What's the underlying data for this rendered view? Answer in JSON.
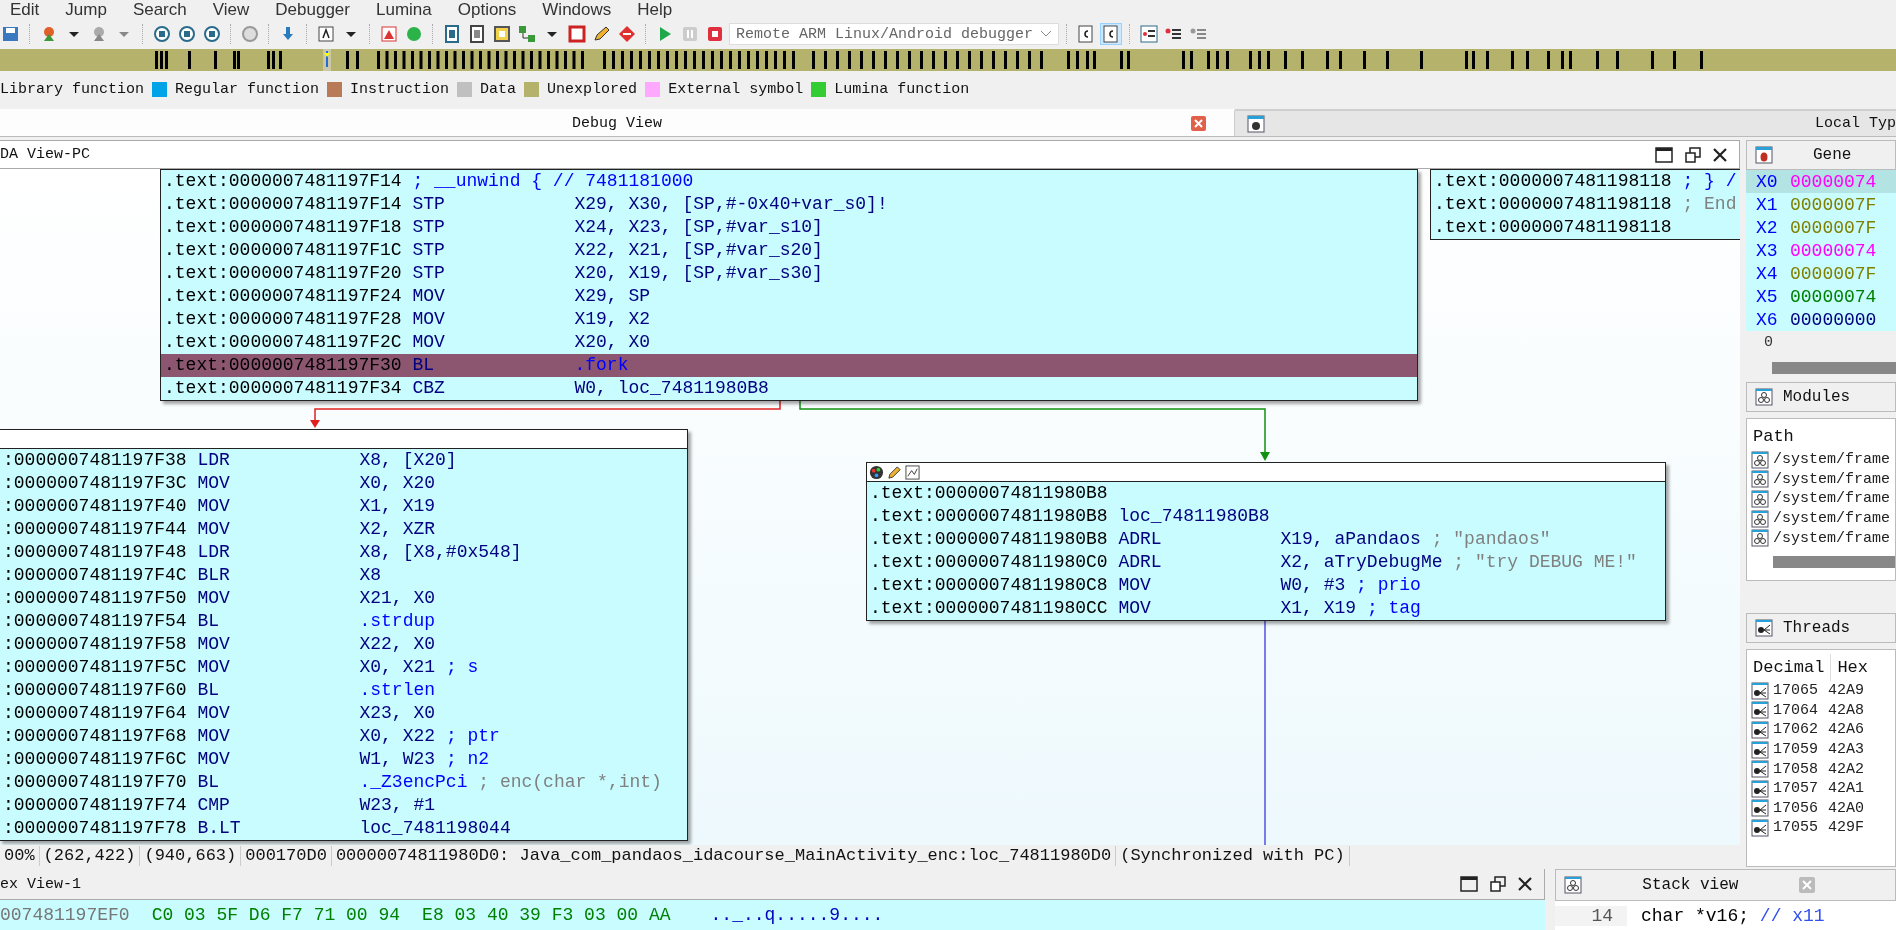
{
  "menu": [
    "Edit",
    "Jump",
    "Search",
    "View",
    "Debugger",
    "Lumina",
    "Options",
    "Windows",
    "Help"
  ],
  "toolbar": {
    "debugger_select": "Remote ARM Linux/Android debugger"
  },
  "legend": [
    {
      "label": "Library function"
    },
    {
      "label": "Regular function",
      "color": "#00a2e8"
    },
    {
      "label": "Instruction",
      "color": "#b97a57"
    },
    {
      "label": "Data",
      "color": "#c0c0c0"
    },
    {
      "label": "Unexplored",
      "color": "#b5b36b"
    },
    {
      "label": "External symbol",
      "color": "#ffa8ff"
    },
    {
      "label": "Lumina function",
      "color": "#33cc33"
    }
  ],
  "tabs": [
    {
      "label": "Debug View",
      "selected": true
    },
    {
      "label": "Local Typ",
      "selected": false
    }
  ],
  "ida_view": {
    "title": "DA View-PC",
    "blocks": [
      {
        "kind": "cut",
        "lines": [
          {
            "addr": ".text:0000007481197F14",
            "comment": "; __unwind { // 7481181000",
            "comment_grey": false,
            "selected": false
          },
          {
            "addr": ".text:0000007481197F14",
            "mnem": "STP",
            "ops": "X29, X30, [SP,#-0x40+var_s0]!",
            "selected": false
          },
          {
            "addr": ".text:0000007481197F18",
            "mnem": "STP",
            "ops": "X24, X23, [SP,#var_s10]",
            "selected": false
          },
          {
            "addr": ".text:0000007481197F1C",
            "mnem": "STP",
            "ops": "X22, X21, [SP,#var_s20]",
            "selected": false
          },
          {
            "addr": ".text:0000007481197F20",
            "mnem": "STP",
            "ops": "X20, X19, [SP,#var_s30]",
            "selected": false
          },
          {
            "addr": ".text:0000007481197F24",
            "mnem": "MOV",
            "ops": "X29, SP",
            "selected": false
          },
          {
            "addr": ".text:0000007481197F28",
            "mnem": "MOV",
            "ops": "X19, X2",
            "selected": false
          },
          {
            "addr": ".text:0000007481197F2C",
            "mnem": "MOV",
            "ops": "X20, X0",
            "selected": false
          },
          {
            "addr": ".text:0000007481197F30",
            "mnem": "BL",
            "ops": ".fork",
            "call": true,
            "selected": true
          },
          {
            "addr": ".text:0000007481197F34",
            "mnem": "CBZ",
            "ops": "W0, loc_74811980B8",
            "selected": false
          }
        ]
      },
      {
        "kind": "cut",
        "lines": [
          {
            "addr": ".text:0000007481198118",
            "comment": "; } /",
            "comment_grey": false
          },
          {
            "addr": ".text:0000007481198118",
            "comment": "; End",
            "comment_grey": true
          },
          {
            "addr": ".text:0000007481198118"
          }
        ]
      },
      {
        "kind": "header",
        "lines": [
          {
            "addr": ":0000007481197F38",
            "mnem": "LDR",
            "ops": "X8, [X20]"
          },
          {
            "addr": ":0000007481197F3C",
            "mnem": "MOV",
            "ops": "X0, X20"
          },
          {
            "addr": ":0000007481197F40",
            "mnem": "MOV",
            "ops": "X1, X19"
          },
          {
            "addr": ":0000007481197F44",
            "mnem": "MOV",
            "ops": "X2, XZR"
          },
          {
            "addr": ":0000007481197F48",
            "mnem": "LDR",
            "ops": "X8, [X8,#0x548]"
          },
          {
            "addr": ":0000007481197F4C",
            "mnem": "BLR",
            "ops": "X8"
          },
          {
            "addr": ":0000007481197F50",
            "mnem": "MOV",
            "ops": "X21, X0"
          },
          {
            "addr": ":0000007481197F54",
            "mnem": "BL",
            "ops": ".strdup",
            "call": true
          },
          {
            "addr": ":0000007481197F58",
            "mnem": "MOV",
            "ops": "X22, X0"
          },
          {
            "addr": ":0000007481197F5C",
            "mnem": "MOV",
            "ops": "X0, X21",
            "comment": "; s",
            "comment_grey": false
          },
          {
            "addr": ":0000007481197F60",
            "mnem": "BL",
            "ops": ".strlen",
            "call": true
          },
          {
            "addr": ":0000007481197F64",
            "mnem": "MOV",
            "ops": "X23, X0"
          },
          {
            "addr": ":0000007481197F68",
            "mnem": "MOV",
            "ops": "X0, X22",
            "comment": "; ptr",
            "comment_grey": false
          },
          {
            "addr": ":0000007481197F6C",
            "mnem": "MOV",
            "ops": "W1, W23",
            "comment": "; n2",
            "comment_grey": false
          },
          {
            "addr": ":0000007481197F70",
            "mnem": "BL",
            "ops": "._Z3encPci",
            "call": true,
            "comment": "; enc(char *,int)",
            "comment_grey": true
          },
          {
            "addr": ":0000007481197F74",
            "mnem": "CMP",
            "ops": "W23, #1"
          },
          {
            "addr": ":0000007481197F78",
            "mnem": "B.LT",
            "ops": "loc_7481198044"
          }
        ]
      },
      {
        "kind": "tools",
        "lines": [
          {
            "addr": ".text:00000074811980B8"
          },
          {
            "addr": ".text:00000074811980B8",
            "mnem": "loc_74811980B8"
          },
          {
            "addr": ".text:00000074811980B8",
            "mnem": "ADRL",
            "ops": "X19, aPandaos",
            "comment": "; \"pandaos\"",
            "comment_grey": true
          },
          {
            "addr": ".text:00000074811980C0",
            "mnem": "ADRL",
            "ops": "X2, aTryDebugMe",
            "comment": "; \"try DEBUG ME!\"",
            "comment_grey": true
          },
          {
            "addr": ".text:00000074811980C8",
            "mnem": "MOV",
            "ops": "W0, #3",
            "comment": "; prio",
            "comment_grey": false
          },
          {
            "addr": ".text:00000074811980CC",
            "mnem": "MOV",
            "ops": "X1, X19",
            "comment": "; tag",
            "comment_grey": false
          }
        ]
      }
    ],
    "status": [
      "00%",
      "(262,422)",
      "(940,663)",
      "000170D0",
      "00000074811980D0: Java_com_pandaos_idacourse_MainActivity_enc:loc_74811980D0",
      "(Synchronized with PC)"
    ]
  },
  "registers": {
    "title": "Gene",
    "rows": [
      {
        "name": "X0",
        "value": "00000074",
        "color": "#ff00ff",
        "selected": true
      },
      {
        "name": "X1",
        "value": "0000007F",
        "color": "#808000",
        "selected": false
      },
      {
        "name": "X2",
        "value": "0000007F",
        "color": "#808000",
        "selected": false
      },
      {
        "name": "X3",
        "value": "00000074",
        "color": "#ff00ff",
        "selected": false
      },
      {
        "name": "X4",
        "value": "0000007F",
        "color": "#808000",
        "selected": false
      },
      {
        "name": "X5",
        "value": "00000074",
        "color": "#008000",
        "selected": false
      },
      {
        "name": "X6",
        "value": "00000000",
        "color": "#000080",
        "selected": false
      }
    ],
    "footer": "0"
  },
  "modules": {
    "title": "Modules",
    "column": "Path",
    "rows": [
      "/system/frame",
      "/system/frame",
      "/system/frame",
      "/system/frame",
      "/system/frame"
    ]
  },
  "threads": {
    "title": "Threads",
    "columns": [
      "Decimal",
      "Hex"
    ],
    "rows": [
      [
        "17065",
        "42A9"
      ],
      [
        "17064",
        "42A8"
      ],
      [
        "17062",
        "42A6"
      ],
      [
        "17059",
        "42A3"
      ],
      [
        "17058",
        "42A2"
      ],
      [
        "17057",
        "42A1"
      ],
      [
        "17056",
        "42A0"
      ],
      [
        "17055",
        "429F"
      ]
    ]
  },
  "hex_view": {
    "title": "ex View-1",
    "rows": [
      {
        "addr": "007481197EF0",
        "bytes": [
          "C0 03 5F D6 F7 71 00 94",
          "E8 03 40 39 F3 03 00 AA"
        ],
        "ascii": ".._..q.....9...."
      }
    ]
  },
  "stack_view": {
    "title": "Stack view",
    "lines": [
      {
        "number": "14",
        "code": "char *v16;",
        "comment": "// x11"
      }
    ]
  }
}
